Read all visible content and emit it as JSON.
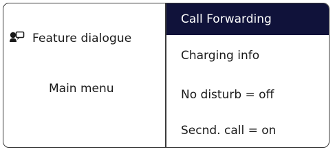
{
  "left_pane": {
    "feature_label": "Feature dialogue",
    "main_menu_label": "Main menu",
    "feature_icon": "speech-bubble-person-icon"
  },
  "menu": {
    "items": [
      {
        "label": "Call Forwarding",
        "selected": true
      },
      {
        "label": "Charging info",
        "selected": false
      },
      {
        "label": "No disturb = off",
        "selected": false
      },
      {
        "label": "Secnd. call = on",
        "selected": false
      }
    ]
  },
  "colors": {
    "selected_bg": "#10123a",
    "selected_fg": "#ffffff",
    "border": "#3a3a3a"
  }
}
